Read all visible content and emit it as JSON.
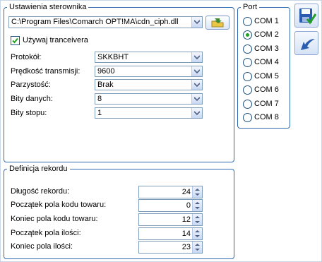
{
  "settings": {
    "legend": "Ustawienia sterownika",
    "driver_path": "C:\\Program Files\\Comarch OPT!MA\\cdn_ciph.dll",
    "use_transceiver_label": "Używaj tranceivera",
    "use_transceiver_checked": true,
    "fields": [
      {
        "label": "Protokół:",
        "value": "SKKBHT"
      },
      {
        "label": "Prędkość transmisji:",
        "value": "9600"
      },
      {
        "label": "Parzystość:",
        "value": "Brak"
      },
      {
        "label": "Bity danych:",
        "value": "8"
      },
      {
        "label": "Bity stopu:",
        "value": "1"
      }
    ]
  },
  "port": {
    "legend": "Port",
    "options": [
      "COM 1",
      "COM 2",
      "COM 3",
      "COM 4",
      "COM 5",
      "COM 6",
      "COM 7",
      "COM 8"
    ],
    "selected": "COM 2"
  },
  "record": {
    "legend": "Definicja rekordu",
    "fields": [
      {
        "label": "Długość rekordu:",
        "value": "24"
      },
      {
        "label": "Początek pola kodu towaru:",
        "value": "0"
      },
      {
        "label": "Koniec pola kodu towaru:",
        "value": "12"
      },
      {
        "label": "Początek pola ilości:",
        "value": "14"
      },
      {
        "label": "Koniec pola ilości:",
        "value": "23"
      }
    ]
  },
  "toolbar": {
    "buttons": [
      {
        "icon": "save-icon"
      },
      {
        "icon": "undo-icon"
      }
    ]
  },
  "colors": {
    "frame_border": "#2f68b3",
    "radio_dot": "#21a121",
    "checkmark": "#21a121",
    "icon_blue": "#2a5db0"
  }
}
